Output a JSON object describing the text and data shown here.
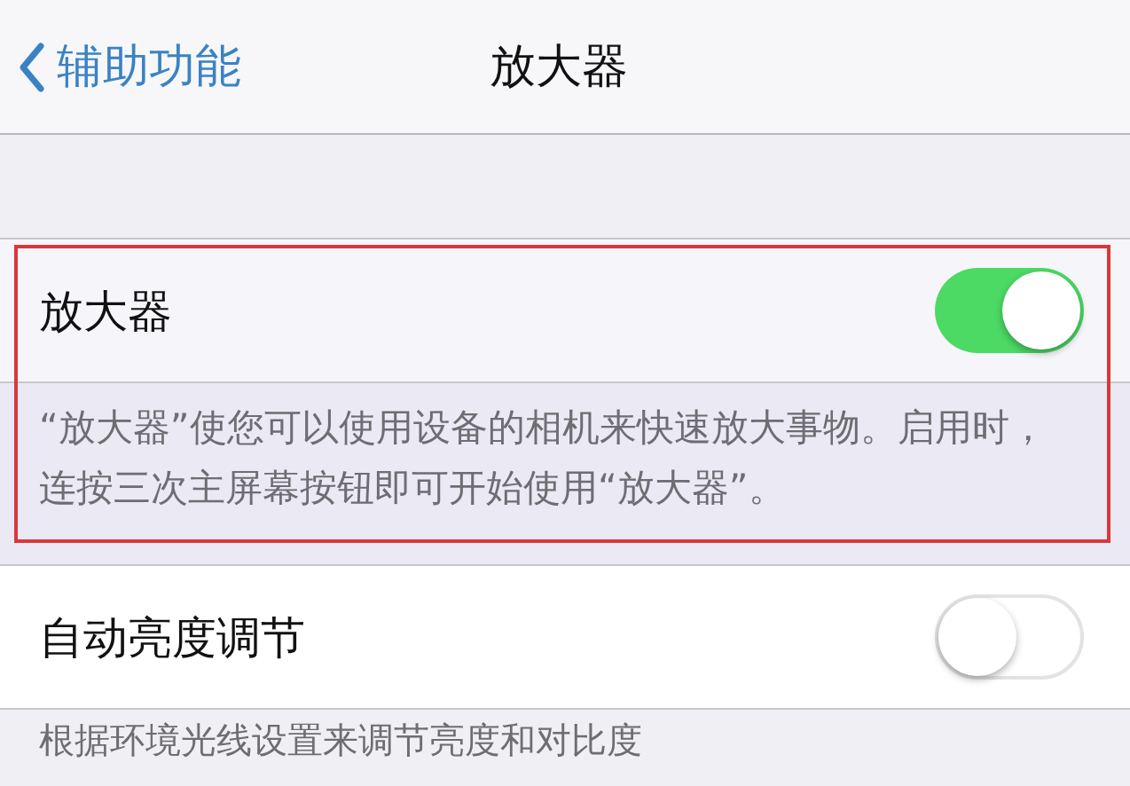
{
  "nav": {
    "back": "辅助功能",
    "title": "放大器"
  },
  "settings": [
    {
      "label": "放大器",
      "on": true,
      "highlighted": true,
      "footer": "“放大器”使您可以使用设备的相机来快速放大事物。启用时，连按三次主屏幕按钮即可开始使用“放大器”。"
    },
    {
      "label": "自动亮度调节",
      "on": false,
      "highlighted": false,
      "footer": "根据环境光线设置来调节亮度和对比度"
    }
  ]
}
